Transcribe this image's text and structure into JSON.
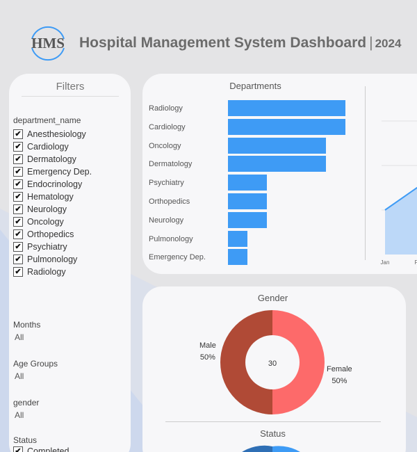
{
  "header": {
    "logo_text": "HMS",
    "title": "Hospital Management System Dashboard",
    "separator": "|",
    "year": "2024"
  },
  "filters": {
    "title": "Filters",
    "department_label": "department_name",
    "departments": [
      {
        "label": "Anesthesiology",
        "checked": "✔"
      },
      {
        "label": "Cardiology",
        "checked": "✔"
      },
      {
        "label": "Dermatology",
        "checked": "✔"
      },
      {
        "label": "Emergency Dep.",
        "checked": "✔"
      },
      {
        "label": "Endocrinology",
        "checked": "✔"
      },
      {
        "label": "Hematology",
        "checked": "✔"
      },
      {
        "label": "Neurology",
        "checked": "✔"
      },
      {
        "label": "Oncology",
        "checked": "✔"
      },
      {
        "label": "Orthopedics",
        "checked": "✔"
      },
      {
        "label": "Psychiatry",
        "checked": "✔"
      },
      {
        "label": "Pulmonology",
        "checked": "✔"
      },
      {
        "label": "Radiology",
        "checked": "✔"
      }
    ],
    "months": {
      "label": "Months",
      "value": "All"
    },
    "age_groups": {
      "label": "Age Groups",
      "value": "All"
    },
    "gender": {
      "label": "gender",
      "value": "All"
    },
    "status": {
      "label": "Status",
      "first_option": "Completed"
    }
  },
  "departments_chart": {
    "title": "Departments",
    "categories": [
      "Radiology",
      "Cardiology",
      "Oncology",
      "Dermatology",
      "Psychiatry",
      "Orthopedics",
      "Neurology",
      "Pulmonology",
      "Emergency Dep."
    ],
    "values": [
      6,
      6,
      5,
      5,
      2,
      2,
      2,
      1,
      1
    ],
    "xlim": [
      0,
      6
    ],
    "bar_color": "#3e9bf5"
  },
  "trend_chart": {
    "x_labels": [
      "Jan",
      "F"
    ],
    "fill_color": "#bcd8f8",
    "line_color": "#3e9bf5"
  },
  "gender_chart": {
    "title": "Gender",
    "center_value": "30",
    "slices": [
      {
        "name": "Male",
        "percent_label": "50%",
        "value": 50,
        "color": "#b04a36"
      },
      {
        "name": "Female",
        "percent_label": "50%",
        "value": 50,
        "color": "#fd6a6a"
      }
    ]
  },
  "status_chart": {
    "title": "Status"
  }
}
